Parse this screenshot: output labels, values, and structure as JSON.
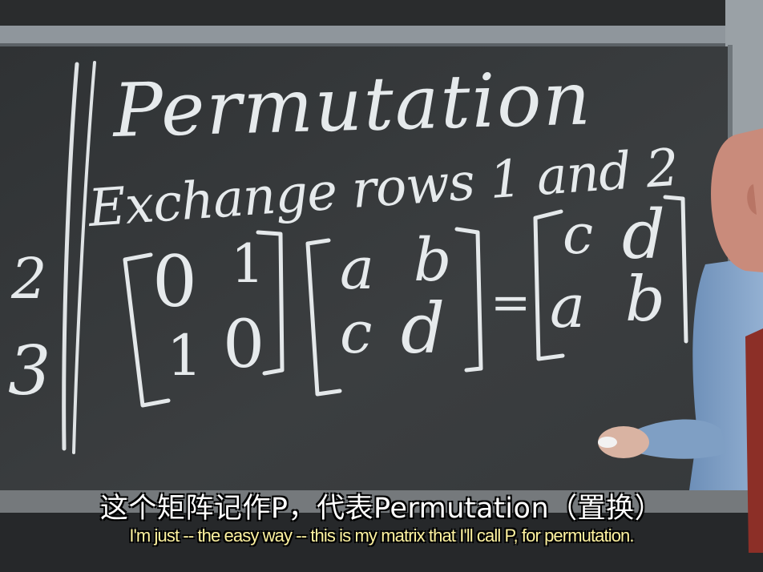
{
  "scene": {
    "description_icon": "lecture-chalkboard-photo",
    "colors": {
      "board": "#3a3d3f",
      "chalk": "#e8ecee",
      "frame": "#8f969c"
    }
  },
  "board": {
    "title": "Permutation",
    "subtitle": "Exchange rows 1 and 2",
    "matrix_p": [
      "0",
      "1",
      "1",
      "0"
    ],
    "matrix_in": [
      "a",
      "b",
      "c",
      "d"
    ],
    "equals": "=",
    "matrix_out": [
      "c",
      "d",
      "a",
      "b"
    ],
    "margin_digits": [
      "2",
      "3"
    ]
  },
  "subtitles": {
    "chinese": "这个矩阵记作P，代表Permutation（置换）",
    "english": "I'm just -- the easy way -- this is my matrix that I'll call P, for permutation."
  }
}
